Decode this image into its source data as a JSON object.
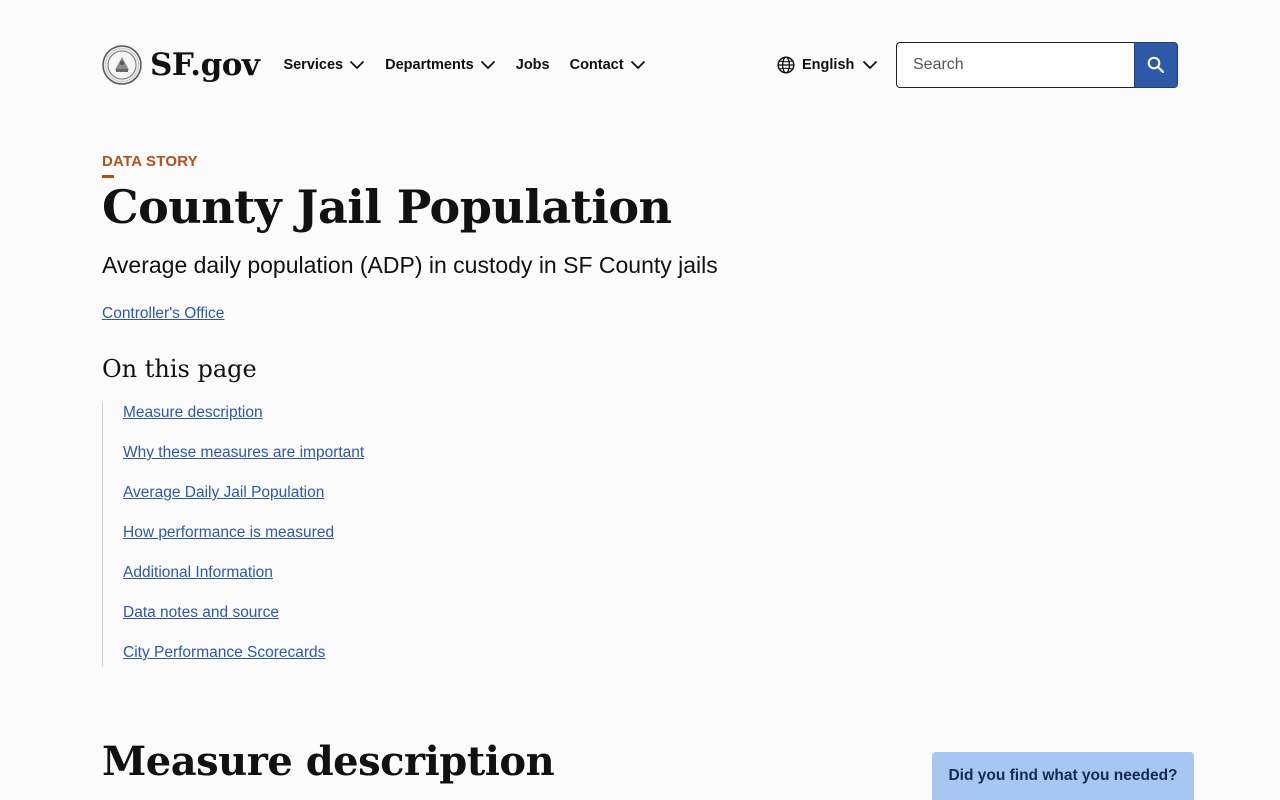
{
  "header": {
    "logo_text": "SF.gov",
    "nav": [
      {
        "label": "Services"
      },
      {
        "label": "Departments"
      },
      {
        "label": "Jobs"
      },
      {
        "label": "Contact"
      }
    ],
    "language": "English",
    "search_placeholder": "Search"
  },
  "main": {
    "eyebrow": "DATA STORY",
    "title": "County Jail Population",
    "subtitle": "Average daily population (ADP) in custody in SF County jails",
    "department_link": "Controller's Office",
    "toc_title": "On this page",
    "toc_items": [
      "Measure description",
      "Why these measures are important",
      "Average Daily Jail Population",
      "How performance is measured",
      "Additional Information",
      "Data notes and source",
      "City Performance Scorecards"
    ],
    "section_title": "Measure description"
  },
  "feedback": {
    "label": "Did you find what you needed?"
  },
  "colors": {
    "accent_orange": "#b3501a",
    "link_blue": "#2e59a8",
    "feedback_bg": "#a8c6f2"
  }
}
